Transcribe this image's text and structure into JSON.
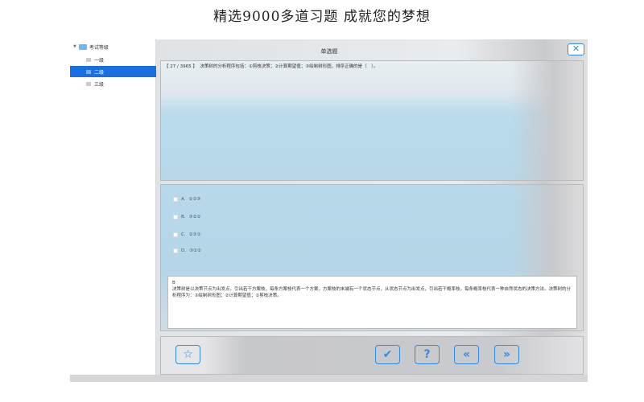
{
  "headline": "精选9000多道习题  成就您的梦想",
  "sidebar": {
    "root": "考试等级",
    "items": [
      {
        "label": "一级"
      },
      {
        "label": "二级"
      },
      {
        "label": "三级"
      }
    ]
  },
  "dialog": {
    "title": "单选题",
    "close_icon": "close-icon"
  },
  "question": {
    "progress": "【 27 / 3965 】",
    "text": "决策树的分析程序包括：①剪枝决策；②计算期望值；③绘制树形图，排序正确的是（　）。"
  },
  "options": [
    {
      "label": "A.",
      "text": "①②③"
    },
    {
      "label": "B.",
      "text": "③②①"
    },
    {
      "label": "C.",
      "text": "②③①"
    },
    {
      "label": "D.",
      "text": "③①②"
    }
  ],
  "answer": {
    "key": "B",
    "explanation": "决策树是以决策节点为出发点，引出若干方案枝，每条方案枝代表一个方案，方案枝的末端有一个状态节点，从状态节点为出发点，引出若干概率枝，每条概率枝代表一种自然状态的决策方法。决策树的分析程序为：③绘制树形图；②计算期望值；①剪枝决策。"
  },
  "toolbar": {
    "favorite": "☆",
    "check": "✔",
    "hint": "?",
    "prev": "«",
    "next": "»"
  }
}
